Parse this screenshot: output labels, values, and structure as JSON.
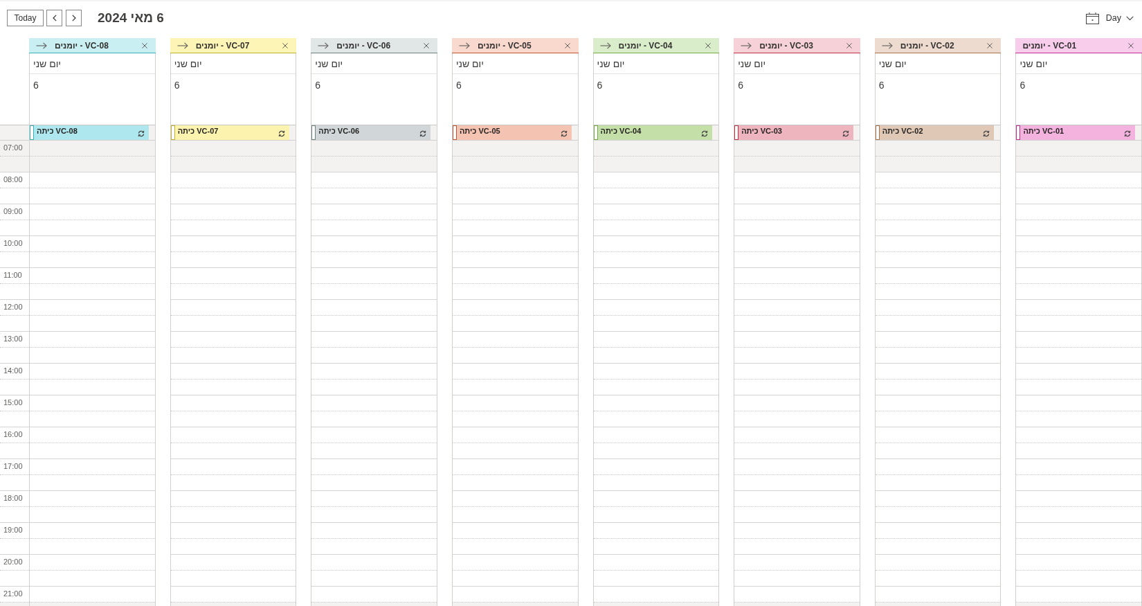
{
  "toolbar": {
    "today_button": "Today",
    "title": "6 מאי 2024",
    "view": {
      "label": "Day"
    }
  },
  "hours": [
    {
      "label": "07:00",
      "slots": [
        {
          "working": false
        },
        {
          "working": false
        }
      ]
    },
    {
      "label": "08:00",
      "slots": [
        {
          "working": true
        },
        {
          "working": true
        }
      ]
    },
    {
      "label": "09:00",
      "slots": [
        {
          "working": true
        },
        {
          "working": true
        }
      ]
    },
    {
      "label": "10:00",
      "slots": [
        {
          "working": true
        },
        {
          "working": true
        }
      ]
    },
    {
      "label": "11:00",
      "slots": [
        {
          "working": true
        },
        {
          "working": true
        }
      ]
    },
    {
      "label": "12:00",
      "slots": [
        {
          "working": true
        },
        {
          "working": true
        }
      ]
    },
    {
      "label": "13:00",
      "slots": [
        {
          "working": true
        },
        {
          "working": true
        }
      ]
    },
    {
      "label": "14:00",
      "slots": [
        {
          "working": true
        },
        {
          "working": true
        }
      ]
    },
    {
      "label": "15:00",
      "slots": [
        {
          "working": true
        },
        {
          "working": true
        }
      ]
    },
    {
      "label": "16:00",
      "slots": [
        {
          "working": true
        },
        {
          "working": true
        }
      ]
    },
    {
      "label": "17:00",
      "slots": [
        {
          "working": true
        },
        {
          "working": true
        }
      ]
    },
    {
      "label": "18:00",
      "slots": [
        {
          "working": true
        },
        {
          "working": true
        }
      ]
    },
    {
      "label": "19:00",
      "slots": [
        {
          "working": true
        },
        {
          "working": true
        }
      ]
    },
    {
      "label": "20:00",
      "slots": [
        {
          "working": true
        },
        {
          "working": true
        }
      ]
    },
    {
      "label": "21:00",
      "slots": [
        {
          "working": true
        },
        {
          "working": false
        }
      ]
    }
  ],
  "calendars": [
    {
      "title": "יומנים - VC-01",
      "color": "#f8cdeb",
      "move_button": false,
      "day_name": "יום שני",
      "day_number": "6",
      "all_day_events": [
        {
          "title": "כיתה VC-01",
          "color": "#f3b3de",
          "recurring": true
        }
      ]
    },
    {
      "title": "יומנים - VC-02",
      "color": "#ecdbce",
      "move_button": true,
      "day_name": "יום שני",
      "day_number": "6",
      "all_day_events": [
        {
          "title": "כיתה VC-02",
          "color": "#dfc8b5",
          "recurring": true
        }
      ]
    },
    {
      "title": "יומנים - VC-03",
      "color": "#f6d1d7",
      "move_button": true,
      "day_name": "יום שני",
      "day_number": "6",
      "all_day_events": [
        {
          "title": "כיתה VC-03",
          "color": "#efb5bf",
          "recurring": true
        }
      ]
    },
    {
      "title": "יומנים - VC-04",
      "color": "#d9edca",
      "move_button": true,
      "day_name": "יום שני",
      "day_number": "6",
      "all_day_events": [
        {
          "title": "כיתה VC-04",
          "color": "#c4e0a8",
          "recurring": true
        }
      ]
    },
    {
      "title": "יומנים - VC-05",
      "color": "#f9d9ce",
      "move_button": true,
      "day_name": "יום שני",
      "day_number": "6",
      "all_day_events": [
        {
          "title": "כיתה VC-05",
          "color": "#f4c3b2",
          "recurring": true
        }
      ]
    },
    {
      "title": "יומנים - VC-06",
      "color": "#e1e6e6",
      "move_button": true,
      "day_name": "יום שני",
      "day_number": "6",
      "all_day_events": [
        {
          "title": "כיתה VC-06",
          "color": "#d1d7d9",
          "recurring": true
        }
      ]
    },
    {
      "title": "יומנים - VC-07",
      "color": "#fdf5b5",
      "move_button": true,
      "day_name": "יום שני",
      "day_number": "6",
      "all_day_events": [
        {
          "title": "כיתה VC-07",
          "color": "#fcf3ae",
          "recurring": true
        }
      ]
    },
    {
      "title": "יומנים - VC-08",
      "color": "#c9eff2",
      "move_button": true,
      "day_name": "יום שני",
      "day_number": "6",
      "all_day_events": [
        {
          "title": "כיתה VC-08",
          "color": "#aee7ed",
          "recurring": true
        }
      ]
    }
  ]
}
